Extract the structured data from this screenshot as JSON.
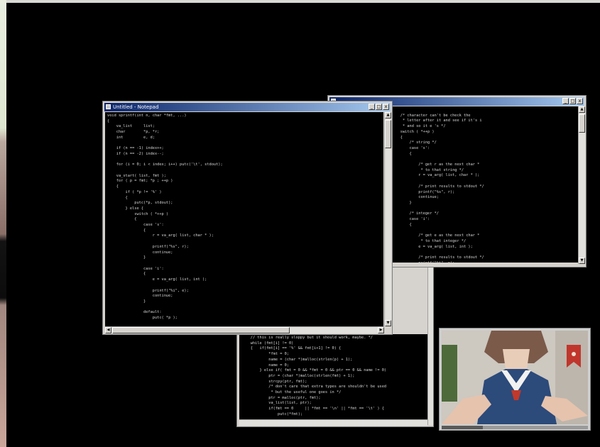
{
  "window_main": {
    "title": "Untitled - Notepad",
    "minimize_glyph": "_",
    "maximize_glyph": "□",
    "close_glyph": "x",
    "code_lines": [
      "void sprintf(int n, char *fmt, ...)",
      "{",
      "    va_list     list;",
      "    char        *p, *r;",
      "    int         e, d;",
      "",
      "    if (n == -1) index++;",
      "    if (n == -2) index--;",
      "",
      "    for (i = 0; i < index; i++) putc('\\t', stdout);",
      "",
      "    va_start( list, fmt );",
      "    for ( p = fmt; *p ; ++p )",
      "    {",
      "        if ( *p != '%' )",
      "        {",
      "            putc(*p, stdout);",
      "        } else {",
      "            switch ( *++p )",
      "            {",
      "                case 's':",
      "                {",
      "                    r = va_arg( list, char * );",
      "",
      "                    printf(\"%s\", r);",
      "                    continue;",
      "                }",
      "",
      "                case 'i':",
      "                {",
      "                    e = va_arg( list, int );",
      "",
      "                    printf(\"%i\", e);",
      "                    continue;",
      "                }",
      "",
      "                default:",
      "                    putc( *p );"
    ]
  },
  "window_right": {
    "title": "",
    "minimize_glyph": "_",
    "maximize_glyph": "□",
    "close_glyph": "x",
    "code_lines": [
      "",
      "    /* character can't be check the",
      "     * letter after it and see if it's i",
      "     * and so it e 's */",
      "    switch ( *++p )",
      "    {",
      "        /* string */",
      "        case 's':",
      "        {",
      "",
      "            /* get r as the next char *",
      "             * to that string */",
      "            r = va_arg( list, char * );",
      "",
      "            /* print results to stdout */",
      "            printf(\"%s\", r);",
      "            continue;",
      "        }",
      "",
      "        /* integer */",
      "        case 'i':",
      "        {",
      "",
      "            /* get e as the next char *",
      "             * to that integer */",
      "            e = va_arg( list, int );",
      "",
      "            /* print results to stdout */",
      "            printf(\"%i\", e);",
      "            continue;"
    ]
  },
  "window_bottom": {
    "code_lines": [
      "    // this is really sloppy but it should work, maybe. */",
      "    while (fmt[i] != 0)",
      "    {   if(fmt[i] == '%' && fmt[i+1] != 0) {",
      "            *fmt = 0;",
      "            name = (char *)malloc(strlen(p) + 1);",
      "            name = 0;",
      "        } else if( fmt = 0 && *fmt = 0 && ptr == 0 && name != 0)",
      "            ptr = (char *)malloc(strlen(fmt) + 1);",
      "            strcpy(ptr, fmt);",
      "            /* don't care that extra types are shouldn't be used",
      "             * but the useful one goes in */",
      "            ptr = malloc(ptr, fmt);",
      "            va_list(list, ptr);",
      "            if(fmt == 0     || *fmt == '\\n' || *fmt == '\\t' ) {",
      "                putc(*fmt);"
    ]
  },
  "video_player": {
    "progress": 0.28
  }
}
